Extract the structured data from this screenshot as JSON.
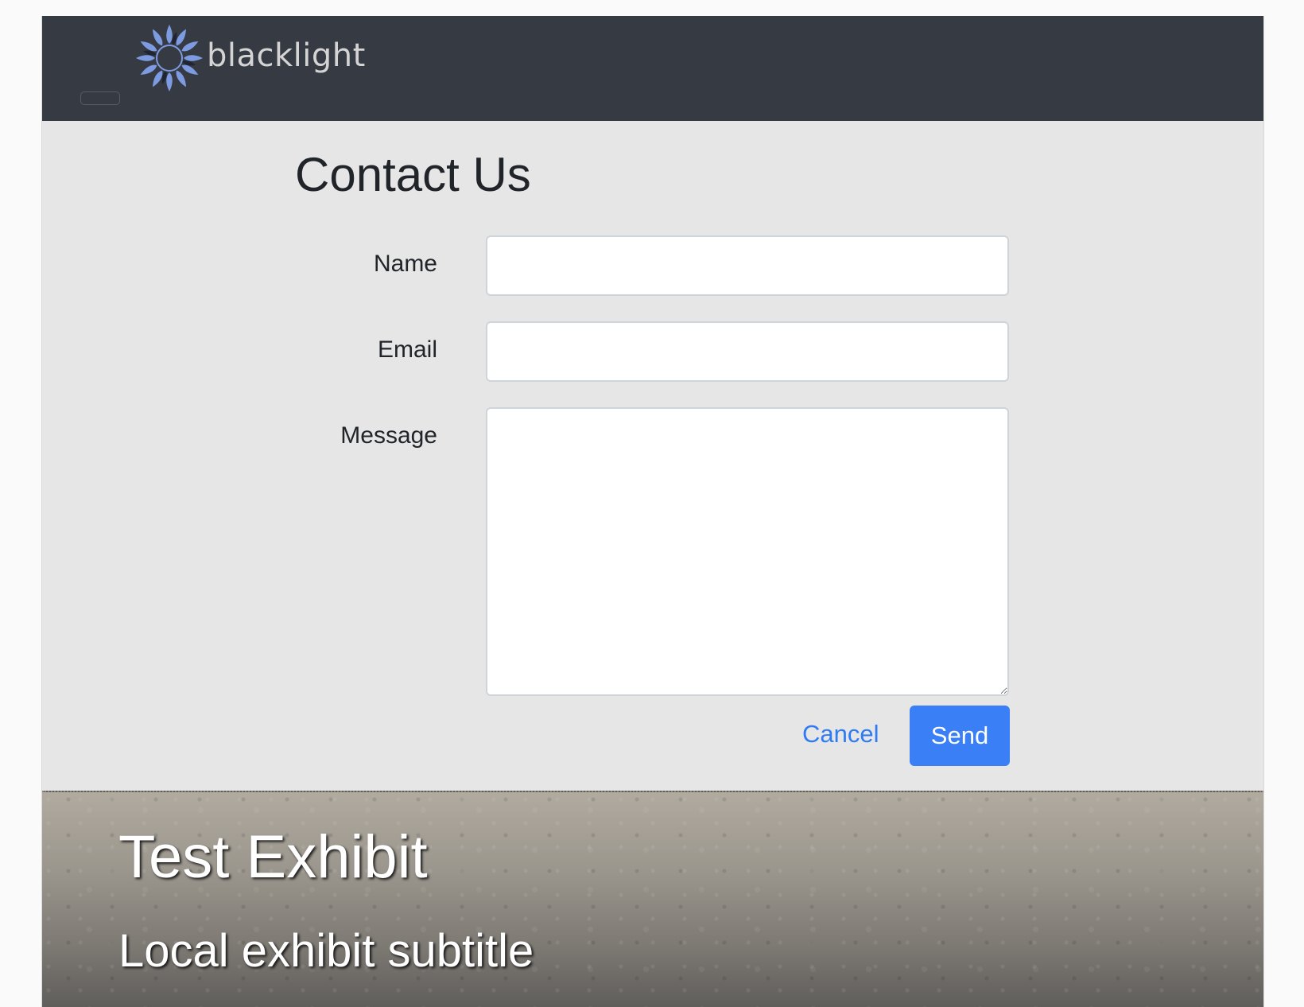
{
  "header": {
    "logo_text": "blacklight",
    "toggler_label": ""
  },
  "contact_form": {
    "title": "Contact Us",
    "fields": {
      "name": {
        "label": "Name",
        "value": ""
      },
      "email": {
        "label": "Email",
        "value": ""
      },
      "message": {
        "label": "Message",
        "value": ""
      }
    },
    "cancel_label": "Cancel",
    "send_label": "Send"
  },
  "masthead": {
    "title": "Test Exhibit",
    "subtitle": "Local exhibit subtitle"
  },
  "colors": {
    "navbar": "#363a43",
    "primary": "#3a7ff5",
    "page_background": "#e6e6e6",
    "logo_mark": "#6f8fd4"
  },
  "icons": {
    "logo_mark": "blacklight-sun-logo-icon"
  }
}
